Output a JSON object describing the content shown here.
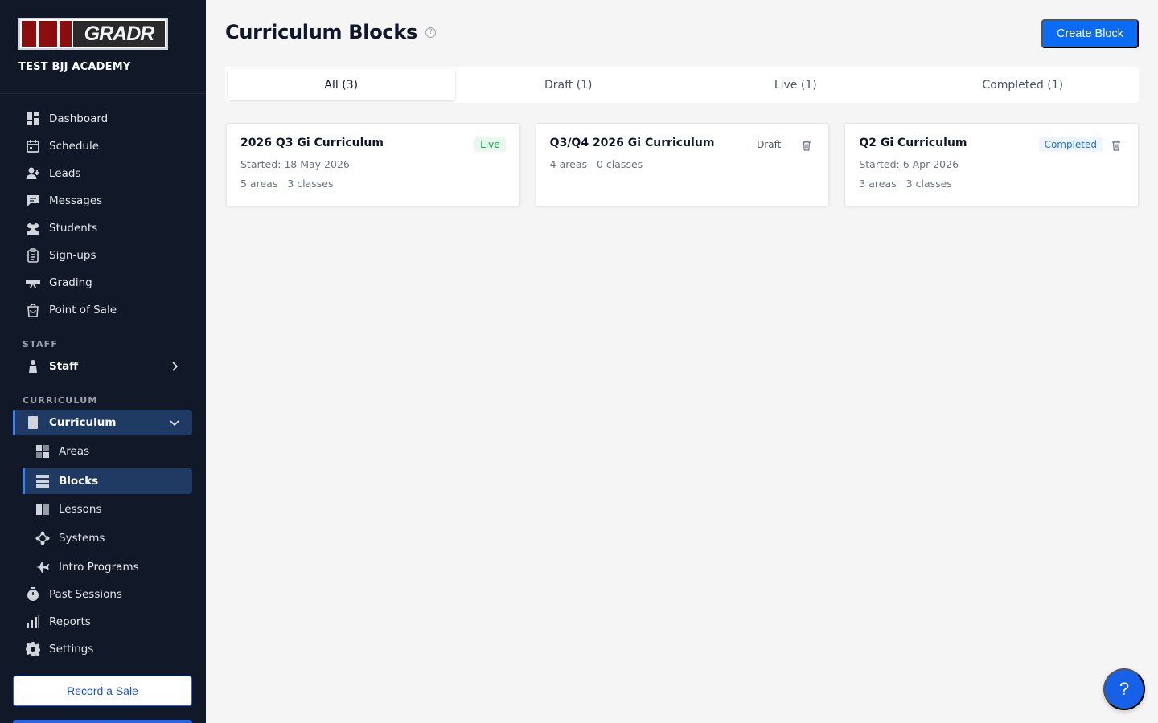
{
  "brand": {
    "logo_text": "GRADR",
    "org_name": "TEST BJJ ACADEMY"
  },
  "sidebar": {
    "items": [
      {
        "label": "Dashboard",
        "icon": "dashboard-icon"
      },
      {
        "label": "Schedule",
        "icon": "calendar-icon"
      },
      {
        "label": "Leads",
        "icon": "user-plus-icon"
      },
      {
        "label": "Messages",
        "icon": "chat-icon"
      },
      {
        "label": "Students",
        "icon": "students-icon"
      },
      {
        "label": "Sign-ups",
        "icon": "clipboard-icon"
      },
      {
        "label": "Grading",
        "icon": "belt-icon"
      },
      {
        "label": "Point of Sale",
        "icon": "shopping-bag-icon"
      }
    ],
    "staff_section": "STAFF",
    "staff_item": "Staff",
    "curriculum_section": "CURRICULUM",
    "curriculum_item": "Curriculum",
    "curriculum_sub": [
      {
        "label": "Areas",
        "icon": "grid-icon"
      },
      {
        "label": "Blocks",
        "icon": "blocks-icon"
      },
      {
        "label": "Lessons",
        "icon": "book-icon"
      },
      {
        "label": "Systems",
        "icon": "network-icon"
      },
      {
        "label": "Intro Programs",
        "icon": "plane-icon"
      }
    ],
    "bottom_items": [
      {
        "label": "Past Sessions",
        "icon": "stopwatch-icon"
      },
      {
        "label": "Reports",
        "icon": "bar-chart-icon"
      },
      {
        "label": "Settings",
        "icon": "gear-icon"
      }
    ],
    "record_sale": "Record a Sale"
  },
  "main": {
    "title": "Curriculum Blocks",
    "create_button": "Create Block",
    "tabs": [
      "All (3)",
      "Draft (1)",
      "Live (1)",
      "Completed (1)"
    ],
    "cards": [
      {
        "title": "2026 Q3 Gi Curriculum",
        "status": "Live",
        "started": "Started: 18 May 2026",
        "areas": "5 areas",
        "classes": "3 classes"
      },
      {
        "title": "Q3/Q4 2026 Gi Curriculum",
        "status": "Draft",
        "started": "",
        "areas": "4 areas",
        "classes": "0 classes"
      },
      {
        "title": "Q2 Gi Curriculum",
        "status": "Completed",
        "started": "Started: 6 Apr 2026",
        "areas": "3 areas",
        "classes": "3 classes"
      }
    ]
  },
  "help_fab": "?",
  "colors": {
    "sidebar_bg": "#111827",
    "accent": "#0a6cf5",
    "live": "#16a34a",
    "completed": "#1d6fe8"
  }
}
